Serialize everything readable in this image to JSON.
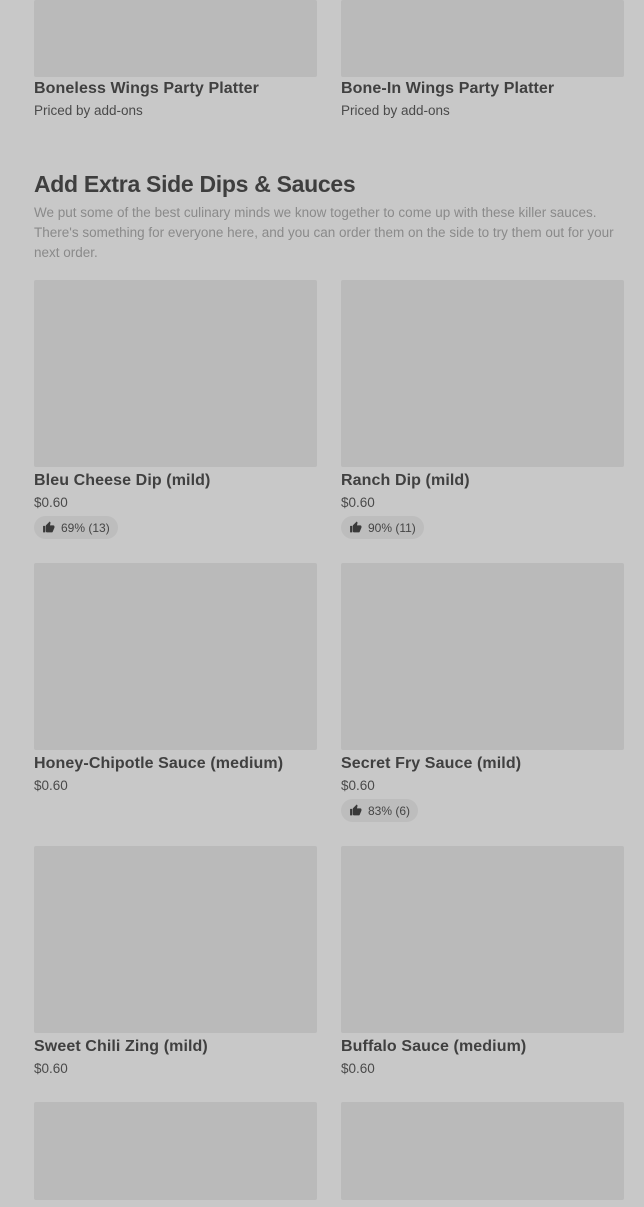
{
  "platters": [
    {
      "name": "Boneless Wings Party Platter",
      "price": "Priced by add-ons"
    },
    {
      "name": "Bone-In Wings Party Platter",
      "price": "Priced by add-ons"
    }
  ],
  "section": {
    "title": "Add Extra Side Dips & Sauces",
    "description": "We put some of the best culinary minds we know together to come up with these killer sauces. There's something for everyone here, and you can order them on the side to try them out for your next order."
  },
  "items": [
    {
      "name": "Bleu Cheese Dip (mild)",
      "price": "$0.60",
      "rating": "69% (13)"
    },
    {
      "name": "Ranch Dip (mild)",
      "price": "$0.60",
      "rating": "90% (11)"
    },
    {
      "name": "Honey-Chipotle Sauce (medium)",
      "price": "$0.60"
    },
    {
      "name": "Secret Fry Sauce (mild)",
      "price": "$0.60",
      "rating": "83% (6)"
    },
    {
      "name": "Sweet Chili Zing (mild)",
      "price": "$0.60"
    },
    {
      "name": "Buffalo Sauce (medium)",
      "price": "$0.60"
    }
  ],
  "icons": {
    "rating": "thumbs-up-icon"
  }
}
